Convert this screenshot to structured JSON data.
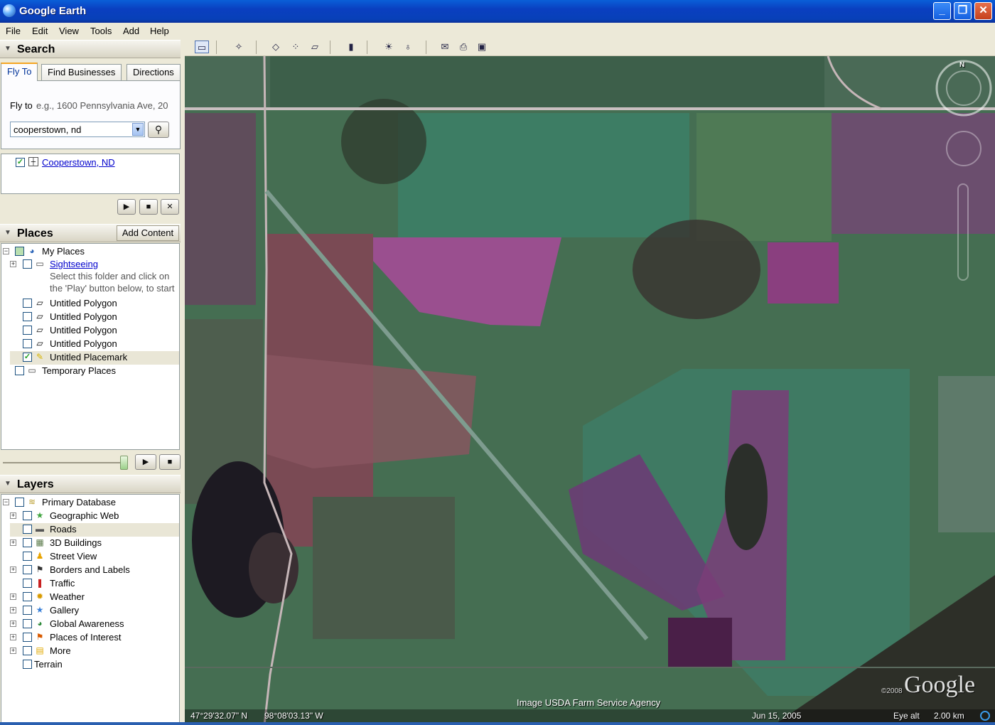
{
  "window": {
    "title": "Google Earth",
    "minimize": "_",
    "maximize": "❐",
    "close": "✕"
  },
  "menu": [
    "File",
    "Edit",
    "View",
    "Tools",
    "Add",
    "Help"
  ],
  "search": {
    "header": "Search",
    "tabs": [
      "Fly To",
      "Find Businesses",
      "Directions"
    ],
    "fly_to_label": "Fly to",
    "fly_to_hint": "e.g., 1600 Pennsylvania Ave, 20",
    "query_value": "cooperstown, nd",
    "results": [
      "Cooperstown, ND"
    ]
  },
  "places": {
    "header": "Places",
    "add_content": "Add Content",
    "my_places": "My Places",
    "sightseeing": "Sightseeing",
    "sightseeing_note_1": "Select this folder and click on",
    "sightseeing_note_2": "the 'Play' button below, to start",
    "polygons": [
      "Untitled Polygon",
      "Untitled Polygon",
      "Untitled Polygon",
      "Untitled Polygon"
    ],
    "placemark": "Untitled Placemark",
    "temporary": "Temporary Places"
  },
  "layers": {
    "header": "Layers",
    "items": [
      {
        "label": "Primary Database",
        "icon": "database-icon",
        "checked": false
      },
      {
        "label": "Geographic Web",
        "icon": "star-icon",
        "checked": false
      },
      {
        "label": "Roads",
        "icon": "road-icon",
        "checked": false
      },
      {
        "label": "3D Buildings",
        "icon": "building-icon",
        "checked": false
      },
      {
        "label": "Street View",
        "icon": "person-icon",
        "checked": false
      },
      {
        "label": "Borders and Labels",
        "icon": "flag-icon",
        "checked": false
      },
      {
        "label": "Traffic",
        "icon": "traffic-icon",
        "checked": false
      },
      {
        "label": "Weather",
        "icon": "sun-icon",
        "checked": false
      },
      {
        "label": "Gallery",
        "icon": "star-icon",
        "checked": false
      },
      {
        "label": "Global Awareness",
        "icon": "globe-icon",
        "checked": false
      },
      {
        "label": "Places of Interest",
        "icon": "flag-icon",
        "checked": false
      },
      {
        "label": "More",
        "icon": "note-icon",
        "checked": false
      },
      {
        "label": "Terrain",
        "icon": "",
        "checked": false
      }
    ]
  },
  "map": {
    "imagery_credit": "Image USDA Farm Service Agency",
    "latitude": "47°29'32.07\" N",
    "longitude": "98°08'03.13\" W",
    "imagery_date": "Jun 15, 2005",
    "eye_alt_label": "Eye alt",
    "eye_alt_value": "2.00 km",
    "logo": "Google",
    "copyright": "©2008",
    "compass_north": "N"
  }
}
